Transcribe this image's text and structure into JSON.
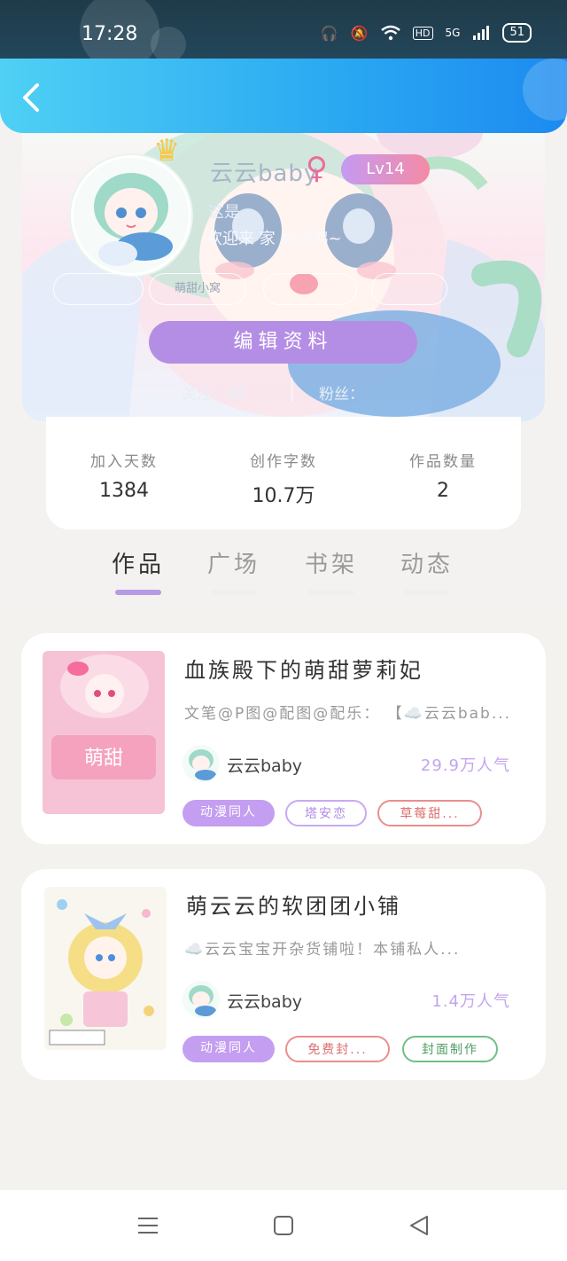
{
  "status_bar": {
    "time": "17:28",
    "battery": "51",
    "hd": "HD",
    "network": "5G"
  },
  "profile": {
    "nickname": "云云baby",
    "gender_symbol": "♀",
    "level": "Lv14",
    "bio_line1": "这是",
    "bio_line2": "欢迎来 家 阅读鸭~",
    "tags": [
      "",
      "萌甜小窝",
      "",
      ""
    ],
    "edit_button": "编辑资料",
    "following_label": "关注：",
    "following_value": "48",
    "fans_label": "粉丝："
  },
  "stats": [
    {
      "label": "加入天数",
      "value": "1384"
    },
    {
      "label": "创作字数",
      "value": "10.7万"
    },
    {
      "label": "作品数量",
      "value": "2"
    }
  ],
  "tabs": [
    {
      "label": "作品",
      "active": true
    },
    {
      "label": "广场",
      "active": false
    },
    {
      "label": "书架",
      "active": false
    },
    {
      "label": "动态",
      "active": false
    }
  ],
  "works": [
    {
      "title": "血族殿下的萌甜萝莉妃",
      "description": "文笔@P图@配图@配乐： 【☁️云云bab...",
      "author": "云云baby",
      "popularity": "29.9万人气",
      "tags": [
        {
          "label": "动漫同人",
          "style": "fill"
        },
        {
          "label": "塔安恋",
          "style": "purple"
        },
        {
          "label": "草莓甜...",
          "style": "red"
        }
      ]
    },
    {
      "title": "萌云云的软团团小铺",
      "description": "☁️云云宝宝开杂货铺啦！本铺私人...",
      "author": "云云baby",
      "popularity": "1.4万人气",
      "tags": [
        {
          "label": "动漫同人",
          "style": "fill"
        },
        {
          "label": "免费封...",
          "style": "red"
        },
        {
          "label": "封面制作",
          "style": "green"
        }
      ]
    }
  ],
  "colors": {
    "accent_purple": "#b48ee4",
    "header_blue": "#2aa8f2",
    "popularity": "#c4a4f0"
  }
}
